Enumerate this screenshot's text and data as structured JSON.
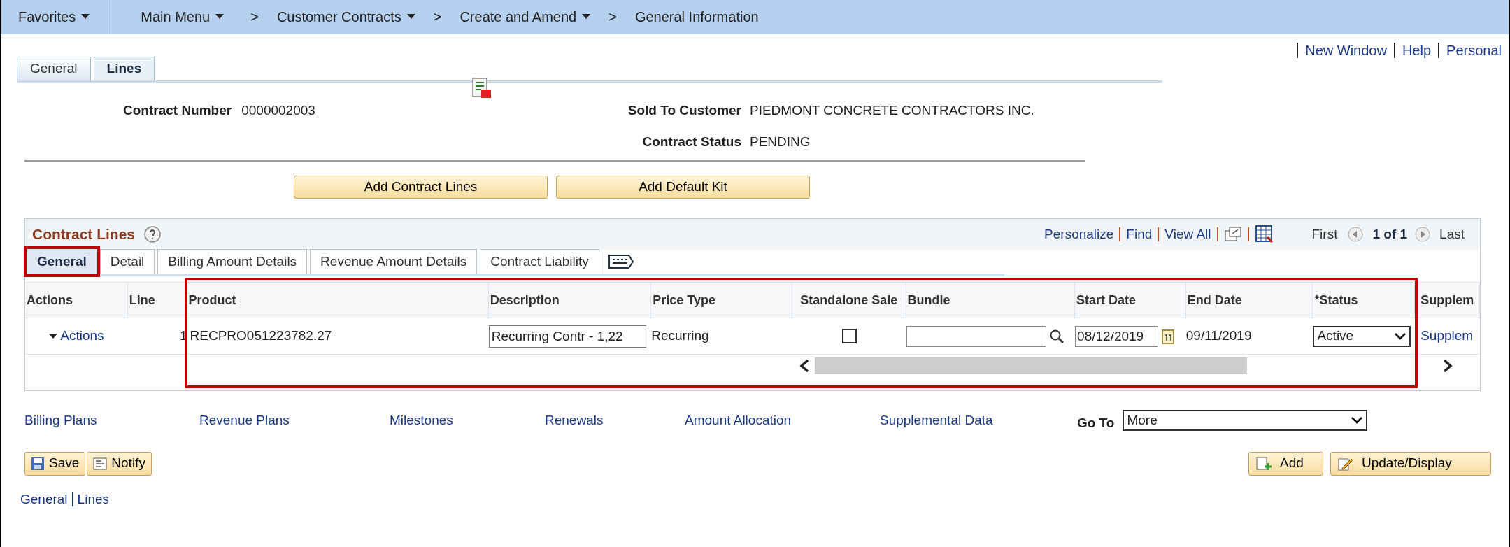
{
  "nav": [
    {
      "kind": "menu",
      "label": "Favorites",
      "dropdown": true
    },
    {
      "kind": "menu",
      "label": "Main Menu",
      "dropdown": true
    },
    {
      "kind": "separator",
      "label": ">"
    },
    {
      "kind": "link",
      "label": "Customer Contracts",
      "dropdown": true
    },
    {
      "kind": "separator",
      "label": ">"
    },
    {
      "kind": "link",
      "label": "Create and Amend",
      "dropdown": true
    },
    {
      "kind": "separator",
      "label": ">"
    },
    {
      "kind": "link",
      "label": "General Information",
      "dropdown": false
    }
  ],
  "header_links": [
    "New Window",
    "Help",
    "Personal"
  ],
  "page_tabs": [
    {
      "label": "General",
      "selected": false
    },
    {
      "label": "Lines",
      "selected": true
    }
  ],
  "contract_number": {
    "label": "Contract Number",
    "value": "0000002003"
  },
  "sold_to_customer": {
    "label": "Sold To Customer",
    "value": "PIEDMONT CONCRETE CONTRACTORS INC."
  },
  "contract_status": {
    "label": "Contract Status",
    "value": "PENDING"
  },
  "action_buttons": [
    "Add Contract Lines",
    "Add Default Kit"
  ],
  "grid": {
    "title": "Contract Lines",
    "toolbar_links": [
      "Personalize",
      "Find",
      "View All"
    ],
    "first": "First",
    "count": "1 of 1",
    "last": "Last",
    "tabs": [
      {
        "label": "General",
        "selected": true,
        "highlighted": true
      },
      {
        "label": "Detail",
        "selected": false,
        "highlighted": false
      },
      {
        "label": "Billing Amount Details",
        "selected": false,
        "highlighted": false
      },
      {
        "label": "Revenue Amount Details",
        "selected": false,
        "highlighted": false
      },
      {
        "label": "Contract Liability",
        "selected": false,
        "highlighted": false
      }
    ],
    "columns": [
      "Actions",
      "Line",
      "Product",
      "Description",
      "Price Type",
      "Standalone Sale",
      "Bundle",
      "Start Date",
      "End Date",
      "*Status",
      "Supplem"
    ],
    "rows": [
      {
        "actions": "Actions",
        "line": "1",
        "product": "RECPRO051223782.27",
        "description": "Recurring Contr - 1,22",
        "price_type": "Recurring",
        "standalone_sale": false,
        "start_date": "08/12/2019",
        "end_date": "09/11/2019",
        "status": "Active",
        "supplemental": "Supplem"
      }
    ],
    "highlight_columns": true
  },
  "page_links": [
    "Billing Plans",
    "Revenue Plans",
    "Milestones",
    "Renewals",
    "Amount Allocation",
    "Supplemental Data"
  ],
  "go_to": {
    "label": "Go To",
    "value": "More"
  },
  "left_buttons": [
    {
      "kind": "save",
      "label": "Save"
    },
    {
      "kind": "notify",
      "label": "Notify"
    }
  ],
  "right_buttons": [
    {
      "kind": "add",
      "label": "Add"
    },
    {
      "kind": "update",
      "label": "Update/Display"
    }
  ],
  "footer_links": [
    "General",
    "Lines"
  ]
}
